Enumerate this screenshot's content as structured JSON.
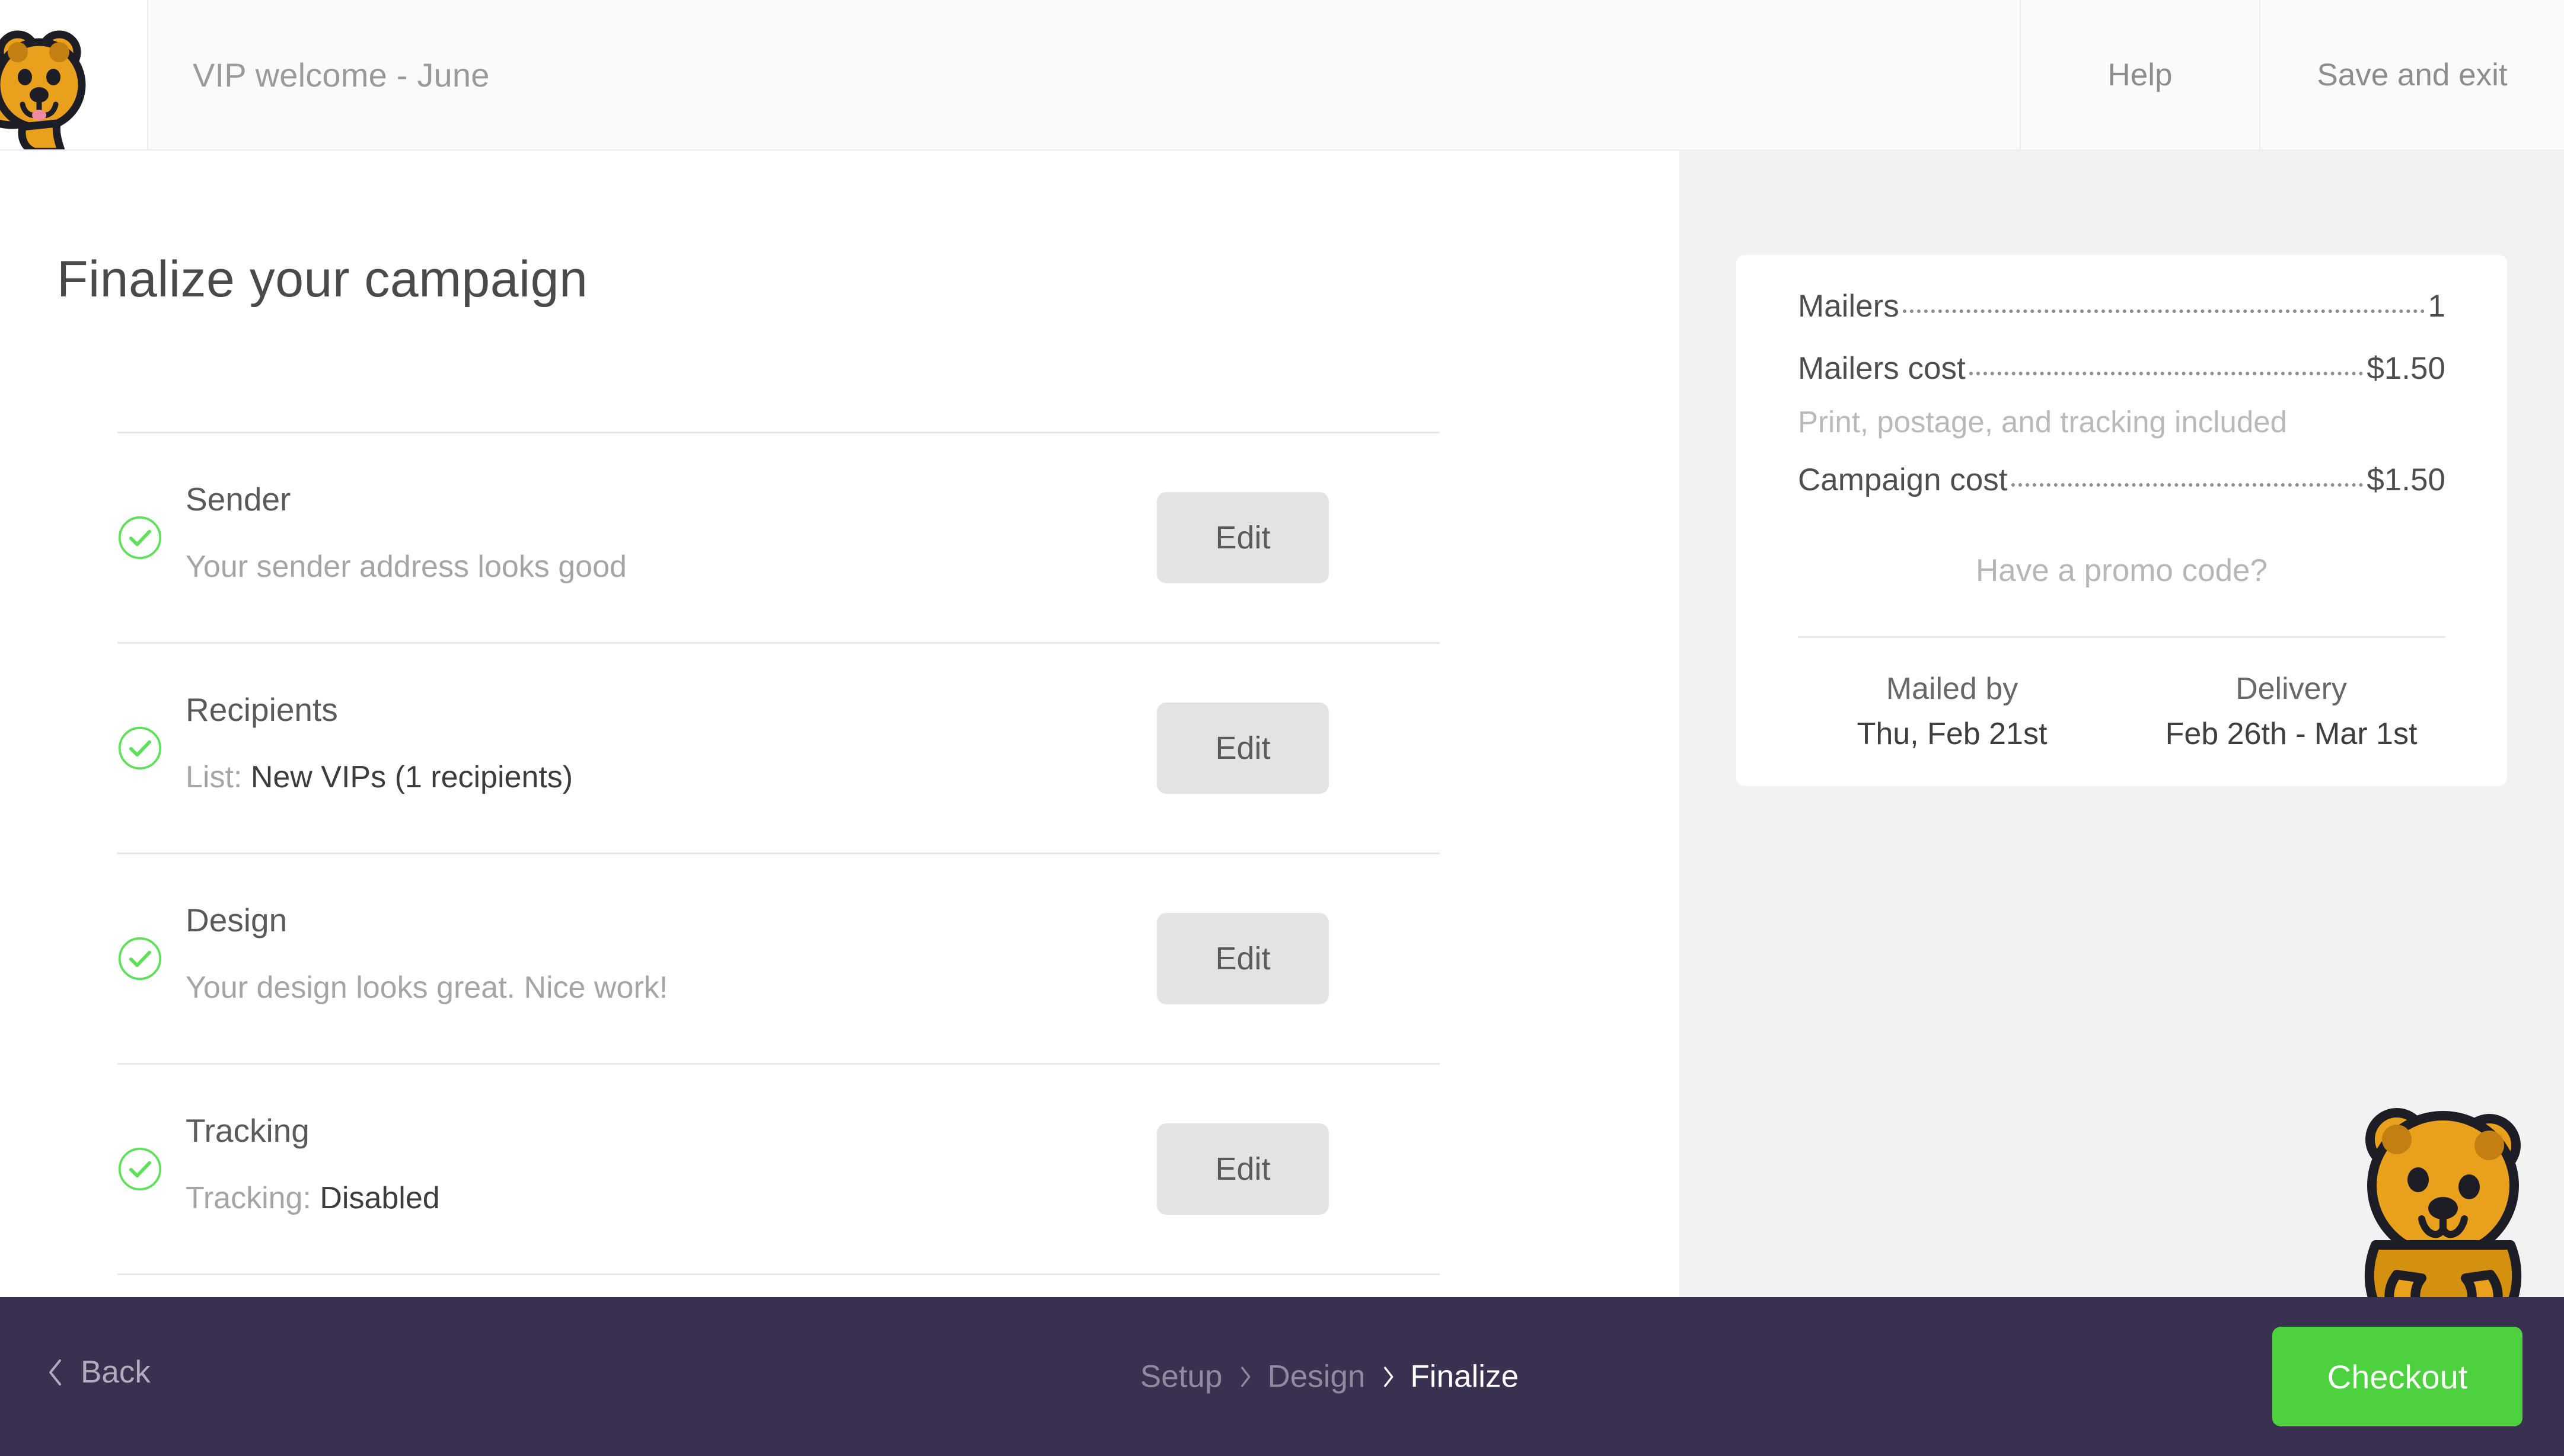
{
  "header": {
    "logo_icon": "quokka-logo-icon",
    "campaign_title": "VIP welcome - June",
    "help_label": "Help",
    "save_exit_label": "Save and exit"
  },
  "main": {
    "page_title": "Finalize your campaign",
    "checklist": [
      {
        "status_icon": "check-circle-icon",
        "title": "Sender",
        "sub_prefix": "Your sender address looks good",
        "sub_value": "",
        "edit_label": "Edit"
      },
      {
        "status_icon": "check-circle-icon",
        "title": "Recipients",
        "sub_prefix": "List: ",
        "sub_value": "New VIPs (1 recipients)",
        "edit_label": "Edit"
      },
      {
        "status_icon": "check-circle-icon",
        "title": "Design",
        "sub_prefix": "Your design looks great. Nice work!",
        "sub_value": "",
        "edit_label": "Edit"
      },
      {
        "status_icon": "check-circle-icon",
        "title": "Tracking",
        "sub_prefix": "Tracking: ",
        "sub_value": "Disabled",
        "edit_label": "Edit"
      }
    ]
  },
  "summary": {
    "rows": [
      {
        "label": "Mailers",
        "value": "1"
      },
      {
        "label": "Mailers cost",
        "value": "$1.50"
      }
    ],
    "note": "Print, postage, and tracking included",
    "total": {
      "label": "Campaign cost",
      "value": "$1.50"
    },
    "promo_label": "Have a promo code?",
    "mailed_by_label": "Mailed by",
    "mailed_by_value": "Thu, Feb 21st",
    "delivery_label": "Delivery",
    "delivery_value": "Feb 26th - Mar 1st"
  },
  "footer": {
    "back_label": "Back",
    "back_icon": "chevron-left-icon",
    "breadcrumbs": [
      {
        "label": "Setup",
        "active": false
      },
      {
        "label": "Design",
        "active": false
      },
      {
        "label": "Finalize",
        "active": true
      }
    ],
    "separator_icon": "chevron-right-icon",
    "checkout_label": "Checkout"
  },
  "mascot": {
    "icon": "quokka-mascot-icon"
  },
  "colors": {
    "accent_green": "#4ed13e",
    "check_green": "#5fe05a",
    "footer_purple": "#3a3050",
    "panel_gray": "#f2f2f2",
    "button_gray": "#e3e3e3",
    "quokka_orange": "#e9a01c"
  }
}
